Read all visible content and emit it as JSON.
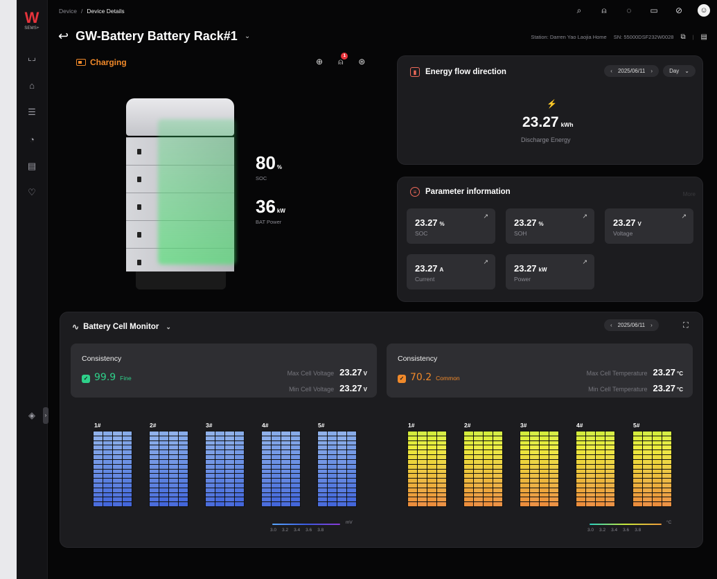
{
  "sidebar": {
    "logo": "W",
    "logo_sub": "SEMS+",
    "items": [
      {
        "icon": "chart-line-icon",
        "glyph": "⌞⌟"
      },
      {
        "icon": "home-dollar-icon",
        "glyph": "⌂"
      },
      {
        "icon": "devices-icon",
        "glyph": "☰"
      },
      {
        "icon": "pie-chart-icon",
        "glyph": "◔"
      },
      {
        "icon": "report-icon",
        "glyph": "▤"
      },
      {
        "icon": "heart-monitor-icon",
        "glyph": "♡"
      },
      {
        "icon": "layers-icon",
        "glyph": "◈"
      }
    ]
  },
  "breadcrumb": {
    "root": "Device",
    "sep": "/",
    "current": "Device Details"
  },
  "topbar_icons": [
    {
      "name": "search-icon",
      "glyph": "⌕"
    },
    {
      "name": "alarm-icon",
      "glyph": "⍝"
    },
    {
      "name": "feedback-icon",
      "glyph": "◌"
    },
    {
      "name": "message-icon",
      "glyph": "▭"
    },
    {
      "name": "help-icon",
      "glyph": "⊘"
    },
    {
      "name": "user-avatar-icon",
      "glyph": "☺"
    }
  ],
  "header": {
    "back_glyph": "↩",
    "title": "GW-Battery Battery Rack#1",
    "chevron": "⌄",
    "station": "Station: Darren Yao Laojia Home",
    "sn": "SN: 55000DSF232W0028",
    "copy_glyph": "⧉",
    "divider": "|",
    "doc_glyph": "▤"
  },
  "device": {
    "status": "Charging",
    "actions": [
      {
        "name": "upload-icon",
        "glyph": "⊕"
      },
      {
        "name": "alarm-icon",
        "glyph": "⍝",
        "badge": "1"
      },
      {
        "name": "settings-icon",
        "glyph": "⊛"
      }
    ],
    "soc_value": "80",
    "soc_unit": "%",
    "soc_label": "SOC",
    "power_value": "36",
    "power_unit": "kW",
    "power_label": "BAT Power"
  },
  "energy_flow": {
    "title": "Energy flow direction",
    "date": "2025/06/11",
    "prev": "‹",
    "next": "›",
    "period": "Day",
    "period_chevron": "⌄",
    "bolt": "⚡",
    "value": "23.27",
    "unit": "kWh",
    "label": "Discharge Energy"
  },
  "parameters": {
    "title": "Parameter information",
    "more": "More",
    "edit_glyph": "↗",
    "items": [
      {
        "value": "23.27",
        "unit": "%",
        "label": "SOC"
      },
      {
        "value": "23.27",
        "unit": "%",
        "label": "SOH"
      },
      {
        "value": "23.27",
        "unit": "V",
        "label": "Voltage"
      },
      {
        "value": "23.27",
        "unit": "A",
        "label": "Current"
      },
      {
        "value": "23.27",
        "unit": "kW",
        "label": "Power"
      }
    ]
  },
  "monitor": {
    "title": "Battery Cell Monitor",
    "wave": "∿",
    "chevron": "⌄",
    "date": "2025/06/11",
    "prev": "‹",
    "next": "›",
    "expand": "⛶",
    "voltage": {
      "title": "Consistency",
      "score": "99.9",
      "level": "Fine",
      "max_label": "Max Cell Voltage",
      "max_value": "23.27",
      "max_unit": "V",
      "min_label": "Min Cell Voltage",
      "min_value": "23.27",
      "min_unit": "V",
      "modules": [
        "1#",
        "2#",
        "3#",
        "4#",
        "5#"
      ],
      "scale": [
        "3.0",
        "3.2",
        "3.4",
        "3.6",
        "3.8"
      ],
      "unit": "mV"
    },
    "temperature": {
      "title": "Consistency",
      "score": "70.2",
      "level": "Common",
      "max_label": "Max Cell Temperature",
      "max_value": "23.27",
      "max_unit": "°C",
      "min_label": "Min Cell Temperature",
      "min_value": "23.27",
      "min_unit": "°C",
      "modules": [
        "1#",
        "2#",
        "3#",
        "4#",
        "5#"
      ],
      "scale": [
        "3.0",
        "3.2",
        "3.4",
        "3.6",
        "3.8"
      ],
      "unit": "°C"
    }
  },
  "colors": {
    "accent_orange": "#f0892a",
    "accent_green": "#2fe07a",
    "fine_green": "#2ed18a",
    "common_orange": "#f0892a",
    "brand_red": "#e5333b"
  }
}
